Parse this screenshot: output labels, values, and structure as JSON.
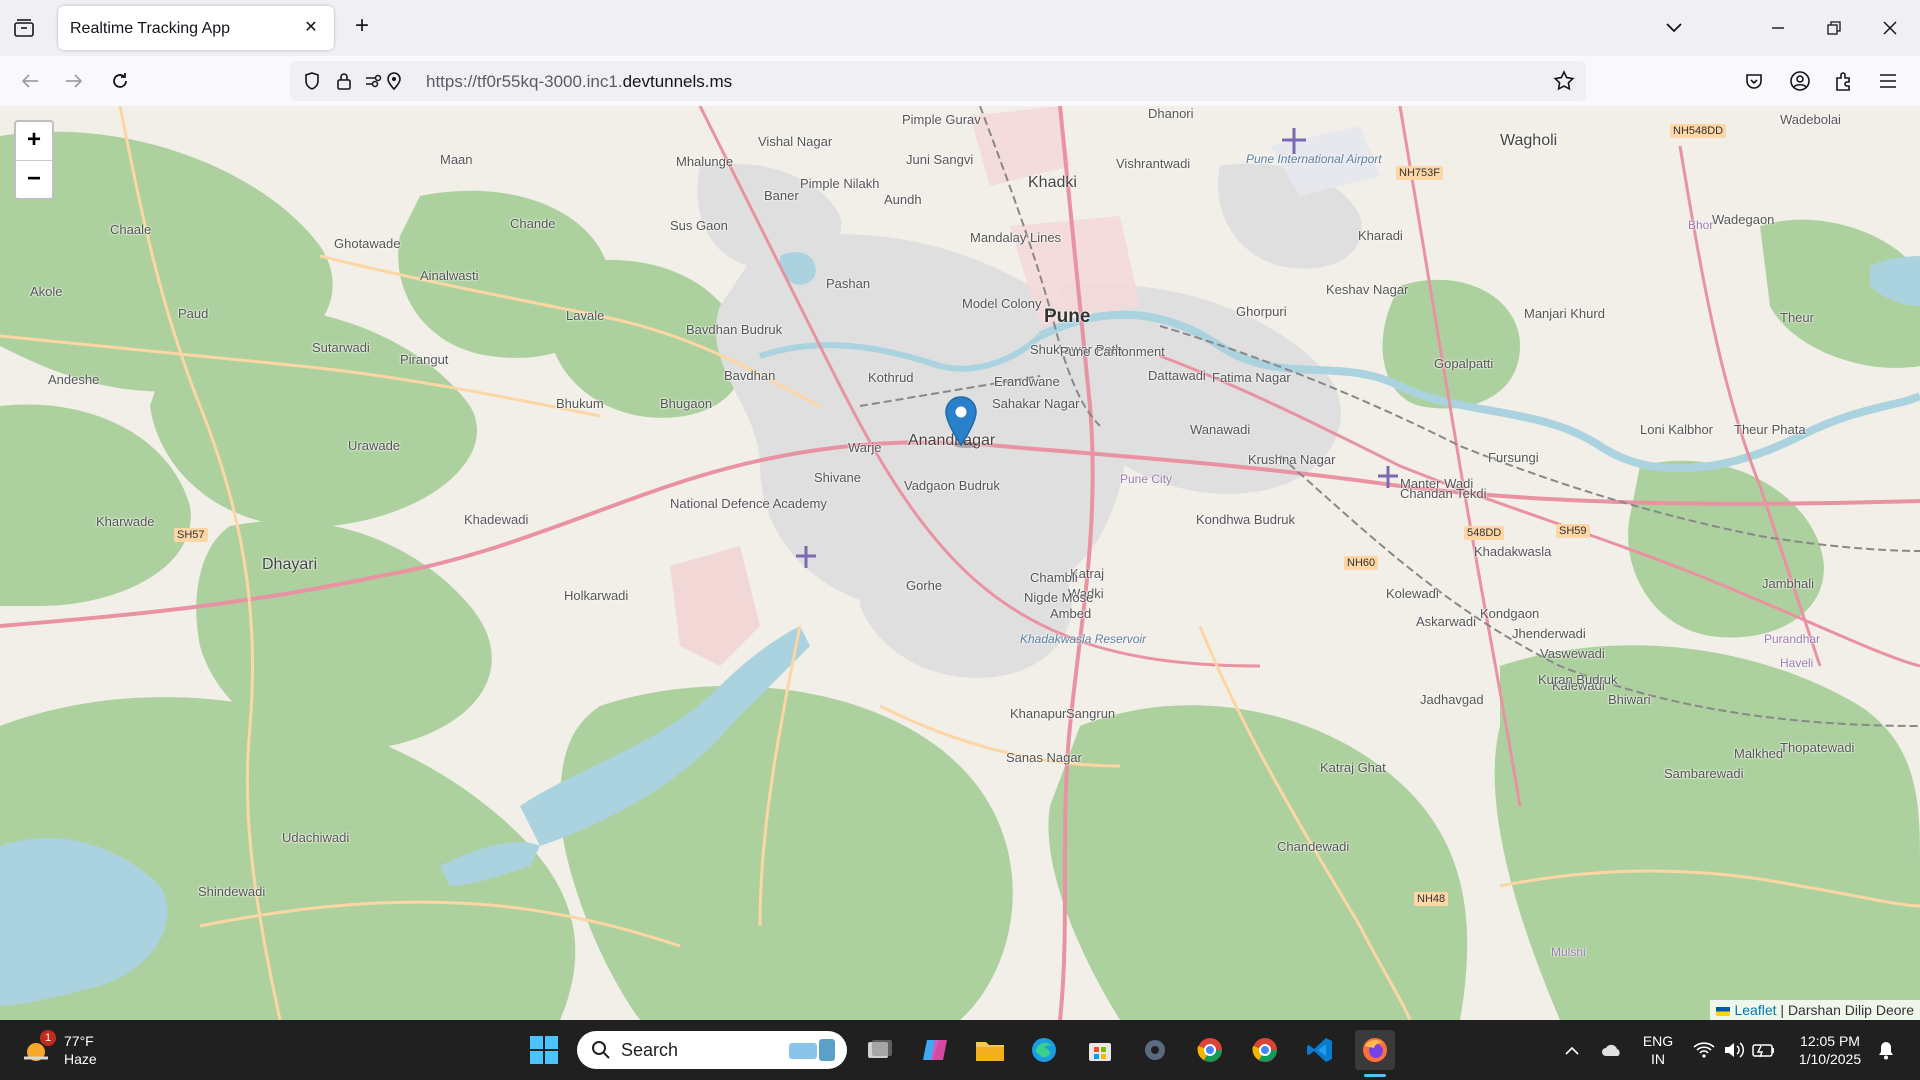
{
  "browser": {
    "tab_title": "Realtime Tracking App",
    "url_prefix": "https://tf0r55kq-3000.inc1.",
    "url_domain": "devtunnels.ms"
  },
  "map": {
    "zoom_in": "+",
    "zoom_out": "−",
    "attribution_link": "Leaflet",
    "attribution_separator": " | ",
    "attribution_author": "Darshan Dilip Deore",
    "place_labels": [
      "Vishal Nagar",
      "Pimple Gurav",
      "Dhanori",
      "Wagholi",
      "Wadebolai",
      "Maan",
      "Mhalunge",
      "Juni Sangvi",
      "Vishrantwadi",
      "Pune International Airport",
      "NH548DD",
      "NH753F",
      "Pimple Nilakh",
      "Khadki",
      "Baner",
      "Aundh",
      "Kharadi",
      "Chaale",
      "Chande",
      "Ghotawade",
      "Sus Gaon",
      "Mandalay Lines",
      "Wadegaon",
      "Ainalwasti",
      "Pashan",
      "Akole",
      "Model Colony",
      "Keshav Nagar",
      "Paud",
      "Lavale",
      "Bavdhan Budruk",
      "Pune",
      "Ghorpuri",
      "Manjari Khurd",
      "Theur",
      "Sutarwadi",
      "Pirangut",
      "Shukrawar Peth",
      "Pune Cantonment",
      "Gopalpatti",
      "Andeshe",
      "Bavdhan",
      "Kothrud",
      "Erandwane",
      "Dattawadi",
      "Fatima Nagar",
      "Bhukum",
      "Bhugaon",
      "Sahakar Nagar",
      "Loni Kalbhor",
      "Theur Phata",
      "Wanawadi",
      "Urawade",
      "Warje",
      "Anandnagar",
      "Krushna Nagar",
      "Fursungi",
      "Shivane",
      "Vadgaon Budruk",
      "Pune City",
      "Manter Wadi",
      "Kharwade",
      "SH57",
      "Khadewadi",
      "National Defence Academy",
      "Katraj",
      "Kondhwa Budruk",
      "548DD",
      "SH59",
      "Khadakwasla",
      "Dhayari",
      "NH60",
      "Holkarwadi",
      "Wadki",
      "Gorhe",
      "Khadakwasla Reservoir",
      "Kolewadi",
      "Askarwadi",
      "Jhenderwadi",
      "Kalewadi",
      "Purandhar",
      "Haveli",
      "Sangrun",
      "Khanapur",
      "Sanas Nagar",
      "Katraj Ghat",
      "Jadhavgad",
      "Bhiwari",
      "Kuran Budruk",
      "Jambhali",
      "Malkhed",
      "Sambarewadi",
      "Thopatewadi",
      "Nigde Mose",
      "Shindewadi",
      "Udachiwadi",
      "Vaswewadi",
      "Chambli",
      "Chandan Tekdi",
      "Kondgaon",
      "Ambed",
      "Chandewadi",
      "NH48",
      "Mulshi",
      "Bhor"
    ],
    "marker_label": "Current location"
  },
  "taskbar": {
    "weather_temp": "77°F",
    "weather_desc": "Haze",
    "weather_badge": "1",
    "search_label": "Search",
    "lang": "ENG",
    "region": "IN",
    "time": "12:05 PM",
    "date": "1/10/2025"
  }
}
